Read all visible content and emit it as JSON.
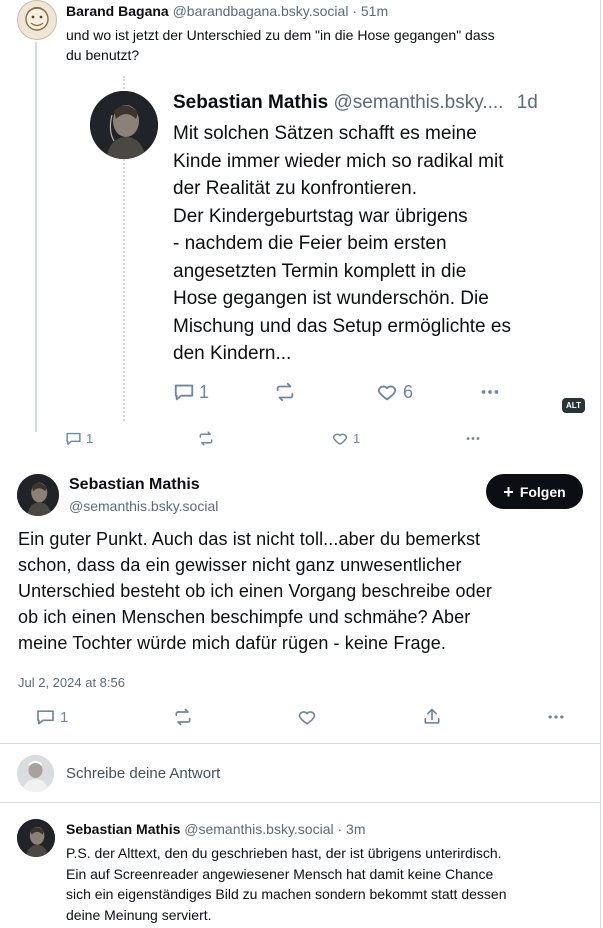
{
  "post_parent": {
    "author_name": "Barand Bagana",
    "author_handle": "@barandbagana.bsky.social",
    "time": "· 51m",
    "text_line1": "und wo ist jetzt der Unterschied zu dem \"in die Hose gegangen\" dass",
    "text_line2": "du benutzt?",
    "actions": {
      "reply_count": "1",
      "like_count": "1"
    }
  },
  "quoted_post": {
    "author_name": "Sebastian Mathis",
    "author_handle": "@semanthis.bsky....",
    "time": "1d",
    "lines": [
      "Mit solchen Sätzen schafft es meine",
      "Kinde immer wieder mich so radikal mit",
      "der Realität zu konfrontieren.",
      "Der Kindergeburtstag war übrigens",
      "- nachdem die Feier beim ersten",
      "angesetzten Termin komplett in die",
      "Hose gegangen ist wunderschön. Die",
      "Mischung und das Setup ermöglichte es",
      "den Kindern..."
    ],
    "actions": {
      "reply_count": "1",
      "like_count": "6"
    },
    "alt_badge": "ALT"
  },
  "main_post": {
    "author_name": "Sebastian Mathis",
    "author_handle": "@semanthis.bsky.social",
    "follow_label": "Folgen",
    "lines": [
      "Ein guter Punkt. Auch das ist nicht toll...aber du bemerkst",
      "schon, dass da ein gewisser nicht ganz unwesentlicher",
      "Unterschied besteht ob ich einen Vorgang beschreibe oder",
      "ob ich einen Menschen beschimpfe und schmähe? Aber",
      "meine Tochter würde mich dafür rügen - keine Frage."
    ],
    "timestamp": "Jul 2, 2024 at 8:56",
    "actions": {
      "reply_count": "1"
    }
  },
  "reply_box": {
    "placeholder": "Schreibe deine Antwort"
  },
  "reply_post": {
    "author_name": "Sebastian Mathis",
    "author_handle": "@semanthis.bsky.social",
    "time": "· 3m",
    "lines": [
      "P.S. der Alttext, den du geschrieben hast, der ist übrigens unterirdisch.",
      "Ein auf Screenreader angewiesener Mensch hat damit keine Chance",
      "sich ein eigenständiges Bild zu machen sondern bekommt statt dessen",
      "deine Meinung serviert."
    ]
  },
  "colors": {
    "icon": "#6f869f",
    "follow_bg": "#0b0f14",
    "divider": "#d4dbe2"
  }
}
